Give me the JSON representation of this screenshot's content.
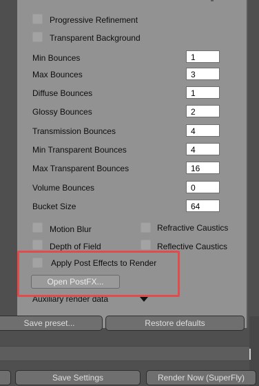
{
  "options": {
    "progressive_refinement": "Progressive Refinement",
    "transparent_background": "Transparent Background"
  },
  "settings": [
    {
      "label": "Min Bounces",
      "value": "1"
    },
    {
      "label": "Max Bounces",
      "value": "3"
    },
    {
      "label": "Diffuse Bounces",
      "value": "1"
    },
    {
      "label": "Glossy Bounces",
      "value": "2"
    },
    {
      "label": "Transmission Bounces",
      "value": "4"
    },
    {
      "label": "Min Transparent Bounces",
      "value": "4"
    },
    {
      "label": "Max Transparent Bounces",
      "value": "16"
    },
    {
      "label": "Volume Bounces",
      "value": "0"
    },
    {
      "label": "Bucket Size",
      "value": "64"
    }
  ],
  "effects": {
    "motion_blur": "Motion Blur",
    "refractive_caustics": "Refractive Caustics",
    "depth_of_field": "Depth of Field",
    "reflective_caustics": "Reflective Caustics"
  },
  "postfx": {
    "apply_label": "Apply Post Effects to Render",
    "open_button": "Open PostFX..."
  },
  "auxiliary": {
    "label": "Auxiliary render data",
    "icon": "triangle-down-icon"
  },
  "preset_bar": {
    "save_preset": "Save preset...",
    "restore_defaults": "Restore defaults"
  },
  "footer": {
    "save_settings": "Save Settings",
    "render_now": "Render Now (SuperFly)"
  },
  "colors": {
    "highlight": "#e14b4b",
    "panel": "#929292",
    "background": "#4f4f4f"
  }
}
